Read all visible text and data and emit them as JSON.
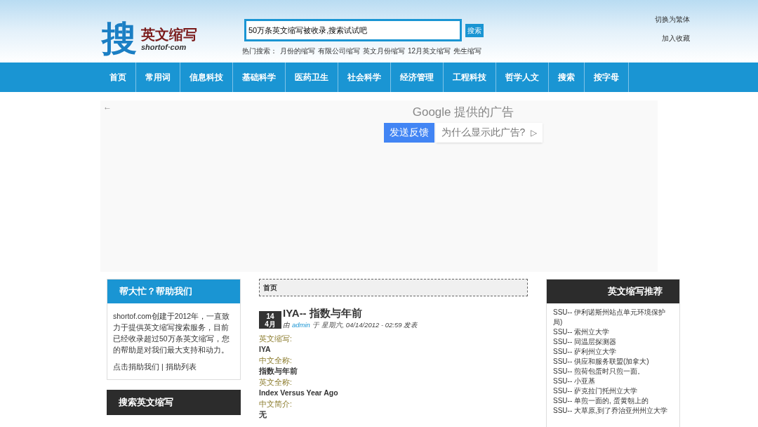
{
  "logo": {
    "mark": "搜",
    "name": "英文缩写",
    "domain": "shortof·com"
  },
  "search": {
    "value": "50万条英文缩写被收录,搜索试试吧",
    "button": "搜索"
  },
  "hot_searches": {
    "label": "热门搜索：",
    "items": [
      "月份的缩写",
      "有限公司缩写",
      "英文月份缩写",
      "12月英文缩写",
      "先生缩写"
    ]
  },
  "top_links": [
    "切换为繁体",
    "加入收藏"
  ],
  "nav": [
    "首页",
    "常用词",
    "信息科技",
    "基础科学",
    "医药卫生",
    "社会科学",
    "经济管理",
    "工程科技",
    "哲学人文",
    "搜索",
    "按字母"
  ],
  "ad": {
    "back": "←",
    "title": "Google 提供的广告",
    "feedback": "发送反馈",
    "why": "为什么显示此广告?",
    "why_icon": "▷"
  },
  "help_box": {
    "title": "帮大忙？帮助我们",
    "text": "shortof.com创建于2012年，一直致力于提供英文缩写搜索服务，目前已经收录超过50万条英文缩写，您的帮助是对我们最大支持和动力。",
    "links": [
      "点击捐助我们",
      "捐助列表"
    ],
    "separator": "|"
  },
  "search_box": {
    "title": "搜索英文缩写"
  },
  "breadcrumb": "首页",
  "article": {
    "day": "14",
    "month": "4月",
    "title": "IYA-- 指数与年前",
    "by": "由",
    "author": "admin",
    "meta": "于 星期六, 04/14/2012 - 02:59 发表",
    "fields": [
      {
        "label": "英文缩写:",
        "value": "IYA"
      },
      {
        "label": "中文全称:",
        "value": "指数与年前"
      },
      {
        "label": "英文全称:",
        "value": "Index Versus Year Ago"
      },
      {
        "label": "中文简介:",
        "value": "无"
      }
    ]
  },
  "recommend": {
    "title": "英文缩写推荐",
    "items": [
      "SSU-- 伊利诺斯州站点单元环境保护局)",
      "SSU-- 索州立大学",
      "SSU-- 同温层探测器",
      "SSU-- 萨利州立大学",
      "SSU-- 供应和服务联盟(加拿大)",
      "SSU-- 煎荷包蛋时只煎一面。",
      "SSU-- 小亚基",
      "SSU-- 萨克拉门托州立大学",
      "SSU-- 单煎一面的, 蛋黄朝上的",
      "SSU-- 大草原,到了乔治亚州州立大学"
    ]
  }
}
